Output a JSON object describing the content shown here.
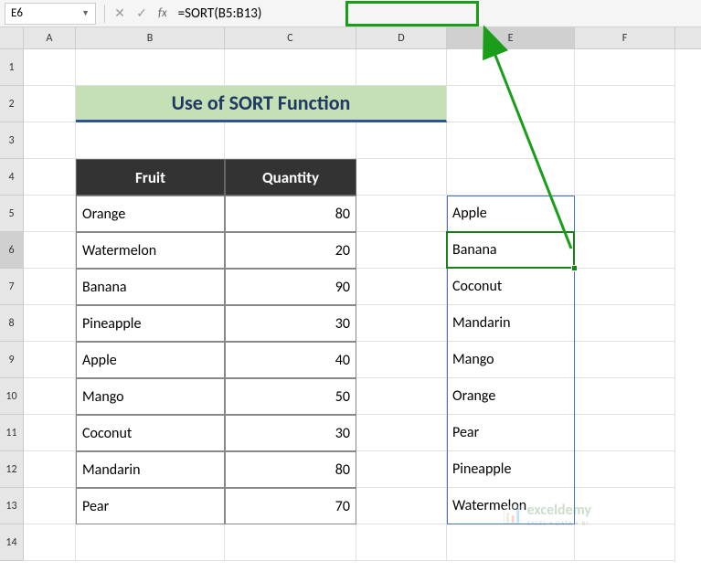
{
  "nameBox": {
    "value": "E6"
  },
  "formulaBar": {
    "formula": "=SORT(B5:B13)"
  },
  "columns": [
    "A",
    "B",
    "C",
    "D",
    "E",
    "F"
  ],
  "rows": [
    "1",
    "2",
    "3",
    "4",
    "5",
    "6",
    "7",
    "8",
    "9",
    "10",
    "11",
    "12",
    "13",
    "14"
  ],
  "title": "Use of SORT Function",
  "table": {
    "headers": {
      "fruit": "Fruit",
      "quantity": "Quantity"
    },
    "data": [
      {
        "fruit": "Orange",
        "quantity": "80"
      },
      {
        "fruit": "Watermelon",
        "quantity": "20"
      },
      {
        "fruit": "Banana",
        "quantity": "90"
      },
      {
        "fruit": "Pineapple",
        "quantity": "30"
      },
      {
        "fruit": "Apple",
        "quantity": "40"
      },
      {
        "fruit": "Mango",
        "quantity": "50"
      },
      {
        "fruit": "Coconut",
        "quantity": "30"
      },
      {
        "fruit": "Mandarin",
        "quantity": "80"
      },
      {
        "fruit": "Pear",
        "quantity": "70"
      }
    ]
  },
  "sorted": [
    "Apple",
    "Banana",
    "Coconut",
    "Mandarin",
    "Mango",
    "Orange",
    "Pear",
    "Pineapple",
    "Watermelon"
  ],
  "activeCell": "E6",
  "watermark": {
    "brand": "exceldemy",
    "tagline": "EXCEL • DATA • BI"
  }
}
